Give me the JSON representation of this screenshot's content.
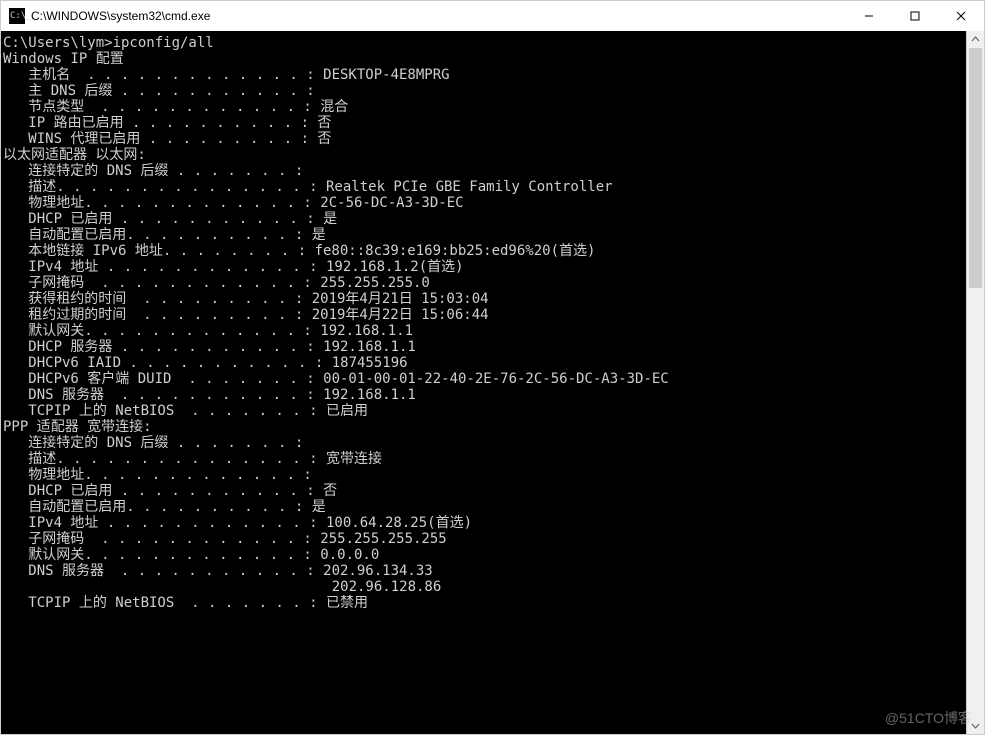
{
  "window": {
    "title": "C:\\WINDOWS\\system32\\cmd.exe",
    "icon_name": "cmd-icon"
  },
  "prompt": "C:\\Users\\lym>",
  "command": "ipconfig/all",
  "sections": {
    "header": "Windows IP 配置",
    "host": [
      {
        "label": "   主机名",
        "dots": "  . . . . . . . . . . . . . : ",
        "value": "DESKTOP-4E8MPRG"
      },
      {
        "label": "   主 DNS 后缀",
        "dots": " . . . . . . . . . . . : ",
        "value": ""
      },
      {
        "label": "   节点类型",
        "dots": "  . . . . . . . . . . . . : ",
        "value": "混合"
      },
      {
        "label": "   IP 路由已启用",
        "dots": " . . . . . . . . . . : ",
        "value": "否"
      },
      {
        "label": "   WINS 代理已启用",
        "dots": " . . . . . . . . . : ",
        "value": "否"
      }
    ],
    "ethernet_title": "以太网适配器 以太网:",
    "ethernet": [
      {
        "label": "   连接特定的 DNS 后缀",
        "dots": " . . . . . . . : ",
        "value": ""
      },
      {
        "label": "   描述",
        "dots": ". . . . . . . . . . . . . . . : ",
        "value": "Realtek PCIe GBE Family Controller"
      },
      {
        "label": "   物理地址",
        "dots": ". . . . . . . . . . . . . : ",
        "value": "2C-56-DC-A3-3D-EC"
      },
      {
        "label": "   DHCP 已启用",
        "dots": " . . . . . . . . . . . : ",
        "value": "是"
      },
      {
        "label": "   自动配置已启用",
        "dots": ". . . . . . . . . . : ",
        "value": "是"
      },
      {
        "label": "   本地链接 IPv6 地址",
        "dots": ". . . . . . . . : ",
        "value": "fe80::8c39:e169:bb25:ed96%20(首选)"
      },
      {
        "label": "   IPv4 地址",
        "dots": " . . . . . . . . . . . . : ",
        "value": "192.168.1.2(首选)"
      },
      {
        "label": "   子网掩码",
        "dots": "  . . . . . . . . . . . . : ",
        "value": "255.255.255.0"
      },
      {
        "label": "   获得租约的时间",
        "dots": "  . . . . . . . . . : ",
        "value": "2019年4月21日 15:03:04"
      },
      {
        "label": "   租约过期的时间",
        "dots": "  . . . . . . . . . : ",
        "value": "2019年4月22日 15:06:44"
      },
      {
        "label": "   默认网关",
        "dots": ". . . . . . . . . . . . . : ",
        "value": "192.168.1.1"
      },
      {
        "label": "   DHCP 服务器",
        "dots": " . . . . . . . . . . . : ",
        "value": "192.168.1.1"
      },
      {
        "label": "   DHCPv6 IAID",
        "dots": " . . . . . . . . . . . : ",
        "value": "187455196"
      },
      {
        "label": "   DHCPv6 客户端 DUID",
        "dots": "  . . . . . . . : ",
        "value": "00-01-00-01-22-40-2E-76-2C-56-DC-A3-3D-EC"
      },
      {
        "label": "   DNS 服务器",
        "dots": "  . . . . . . . . . . . : ",
        "value": "192.168.1.1"
      },
      {
        "label": "   TCPIP 上的 NetBIOS",
        "dots": "  . . . . . . . : ",
        "value": "已启用"
      }
    ],
    "ppp_title": "PPP 适配器 宽带连接:",
    "ppp": [
      {
        "label": "   连接特定的 DNS 后缀",
        "dots": " . . . . . . . : ",
        "value": ""
      },
      {
        "label": "   描述",
        "dots": ". . . . . . . . . . . . . . . : ",
        "value": "宽带连接"
      },
      {
        "label": "   物理地址",
        "dots": ". . . . . . . . . . . . . : ",
        "value": ""
      },
      {
        "label": "   DHCP 已启用",
        "dots": " . . . . . . . . . . . : ",
        "value": "否"
      },
      {
        "label": "   自动配置已启用",
        "dots": ". . . . . . . . . . : ",
        "value": "是"
      },
      {
        "label": "   IPv4 地址",
        "dots": " . . . . . . . . . . . . : ",
        "value": "100.64.28.25(首选)"
      },
      {
        "label": "   子网掩码",
        "dots": "  . . . . . . . . . . . . : ",
        "value": "255.255.255.255"
      },
      {
        "label": "   默认网关",
        "dots": ". . . . . . . . . . . . . : ",
        "value": "0.0.0.0"
      },
      {
        "label": "   DNS 服务器",
        "dots": "  . . . . . . . . . . . : ",
        "value": "202.96.134.33"
      },
      {
        "label": "",
        "dots": "                                       ",
        "value": "202.96.128.86"
      },
      {
        "label": "   TCPIP 上的 NetBIOS",
        "dots": "  . . . . . . . : ",
        "value": "已禁用"
      }
    ]
  },
  "watermark": "@51CTO博客"
}
